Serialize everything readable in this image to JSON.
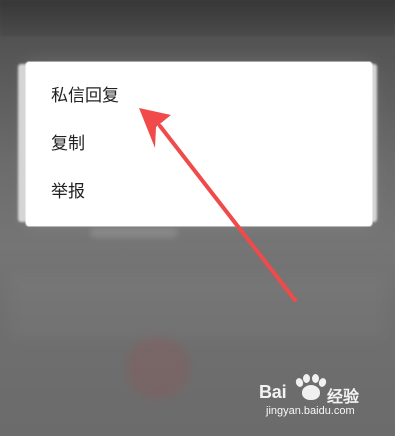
{
  "context_menu": {
    "items": [
      {
        "label": "私信回复"
      },
      {
        "label": "复制"
      },
      {
        "label": "举报"
      }
    ]
  },
  "watermark": {
    "brand_left": "Bai",
    "brand_right": "经验",
    "url": "jingyan.baidu.com"
  },
  "annotation": {
    "icon": "red-arrow-icon",
    "color": "#f04a4a"
  }
}
